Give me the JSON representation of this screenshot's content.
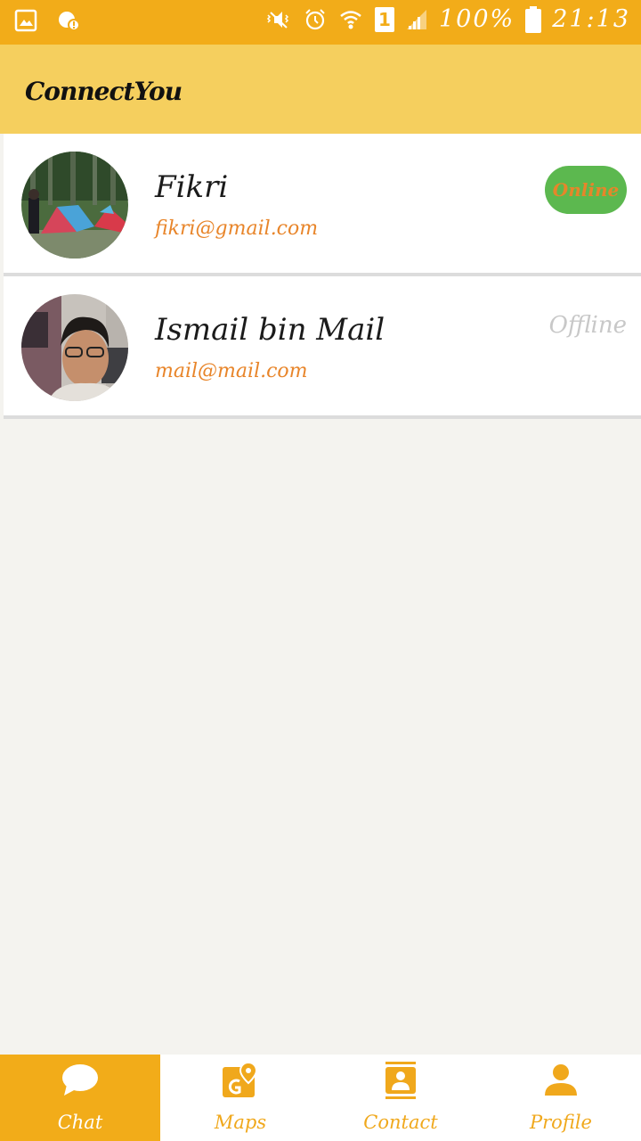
{
  "status_bar": {
    "battery": "100%",
    "time": "21:13",
    "sim_label": "1",
    "icons": [
      "image-icon",
      "notification-icon",
      "mute-icon",
      "alarm-icon",
      "wifi-icon",
      "sim-icon",
      "signal-icon",
      "battery-icon"
    ]
  },
  "app": {
    "title": "ConnectYou"
  },
  "contacts": [
    {
      "name": "Fikri",
      "email": "fikri@gmail.com",
      "status": "Online"
    },
    {
      "name": "Ismail bin Mail",
      "email": "mail@mail.com",
      "status": "Offline"
    }
  ],
  "nav": {
    "items": [
      {
        "label": "Chat",
        "icon": "chat-icon",
        "active": true
      },
      {
        "label": "Maps",
        "icon": "maps-icon",
        "active": false
      },
      {
        "label": "Contact",
        "icon": "contact-icon",
        "active": false
      },
      {
        "label": "Profile",
        "icon": "profile-icon",
        "active": false
      }
    ]
  },
  "colors": {
    "status_bar": "#f2ac19",
    "app_bar": "#f5cf5e",
    "accent": "#f0a81c",
    "email_text": "#e8852a",
    "online_badge": "#5cb84f",
    "offline_text": "#c8c8c8",
    "background": "#f4f3ef"
  }
}
